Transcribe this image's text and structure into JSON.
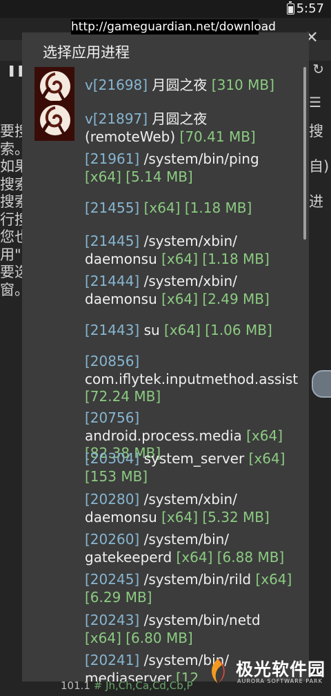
{
  "status_bar": {
    "time": "5:57"
  },
  "url_overlay": "http://gameguardian.net/download",
  "background": {
    "left_text_lines": [
      "要搜",
      "索。",
      "如果",
      "搜索",
      "搜索",
      "行搜",
      "您也",
      "用\"",
      "要选",
      "窗。"
    ],
    "right_text_lines": [
      "搜",
      "",
      "自)",
      "",
      "进",
      "",
      "",
      "",
      "",
      ""
    ],
    "footer": {
      "value": "101.1",
      "tags": "# Jh,Ch,Ca,Cd,Cb,P"
    }
  },
  "dialog": {
    "title": "选择应用进程",
    "processes": [
      {
        "pid": "v[21698]",
        "name": " 月圆之夜 ",
        "meta": "[310 MB]",
        "icon": "moon-night-app-icon"
      },
      {
        "pid": "v[21897]",
        "name": " 月圆之夜 (remoteWeb) ",
        "meta": "[70.41 MB]",
        "icon": "moon-night-app-icon"
      },
      {
        "pid": "[21961]",
        "name": " /system/bin/ping ",
        "meta": "[x64] [5.14 MB]"
      },
      {
        "pid": "[21455]",
        "name": "  ",
        "meta": "[x64] [1.18 MB]"
      },
      {
        "pid": "[21445]",
        "name": " /system/xbin/ daemonsu ",
        "meta": "[x64] [1.18 MB]"
      },
      {
        "pid": "[21444]",
        "name": " /system/xbin/ daemonsu ",
        "meta": "[x64] [2.49 MB]"
      },
      {
        "pid": "[21443]",
        "name": " su ",
        "meta": "[x64] [1.06 MB]"
      },
      {
        "pid": "[20856]",
        "name": " com.iflytek.inputmethod.assist ",
        "meta": "[72.24 MB]"
      },
      {
        "pid": "[20756]",
        "name": " android.process.media ",
        "meta": "[x64] [82.38 MB]"
      },
      {
        "pid": "[20304]",
        "name": " system_server ",
        "meta": "[x64] [153 MB]"
      },
      {
        "pid": "[20280]",
        "name": " /system/xbin/ daemonsu ",
        "meta": "[x64] [5.32 MB]"
      },
      {
        "pid": "[20260]",
        "name": " /system/bin/ gatekeeperd ",
        "meta": "[x64] [6.88 MB]"
      },
      {
        "pid": "[20245]",
        "name": " /system/bin/rild ",
        "meta": "[x64] [6.29 MB]"
      },
      {
        "pid": "[20243]",
        "name": " /system/bin/netd ",
        "meta": "[x64] [6.80 MB]"
      },
      {
        "pid": "[20241]",
        "name": " /system/bin/ mediaserver ",
        "meta": "[12"
      }
    ]
  },
  "watermark": {
    "title": "极光软件园",
    "subtitle": "AURORA SOFTWARE PARK"
  }
}
